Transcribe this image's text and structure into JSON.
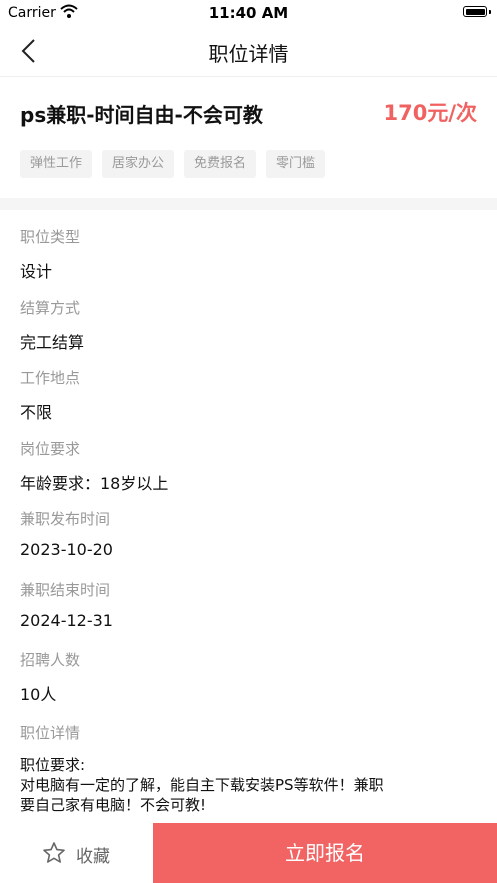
{
  "status_bar": {
    "carrier": "Carrier",
    "time": "11:40 AM"
  },
  "nav": {
    "title": "职位详情"
  },
  "job": {
    "title": "ps兼职-时间自由-不会可教",
    "price": "170元/次",
    "tags": [
      "弹性工作",
      "居家办公",
      "免费报名",
      "零门槛"
    ]
  },
  "fields": [
    {
      "label": "职位类型",
      "value": "设计"
    },
    {
      "label": "结算方式",
      "value": "完工结算"
    },
    {
      "label": "工作地点",
      "value": "不限"
    },
    {
      "label": "岗位要求",
      "value": "年龄要求：18岁以上"
    },
    {
      "label": "兼职发布时间",
      "value": "2023-10-20"
    },
    {
      "label": "兼职结束时间",
      "value": "2024-12-31"
    },
    {
      "label": "招聘人数",
      "value": "10人"
    }
  ],
  "detail": {
    "label": "职位详情",
    "lines": [
      "职位要求:",
      "对电脑有一定的了解，能自主下载安装PS等软件！兼职",
      "要自己家有电脑！不会可教!"
    ]
  },
  "bottom": {
    "favorite_label": "收藏",
    "apply_label": "立即报名"
  },
  "colors": {
    "accent": "#f26464",
    "price": "#f06262"
  }
}
